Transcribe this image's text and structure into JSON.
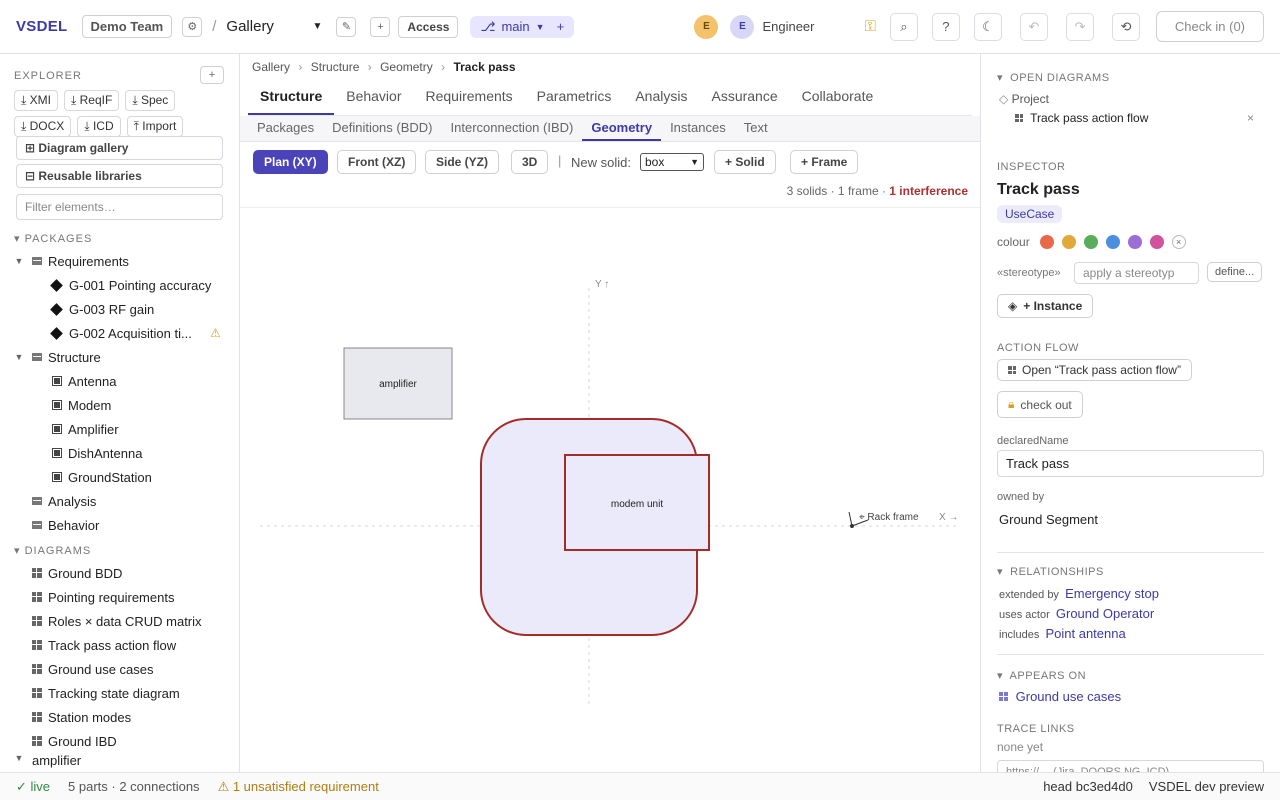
{
  "topbar": {
    "brand": "VSDEL",
    "team": "Demo Team",
    "separator": "/",
    "view_select": "Gallery",
    "access_label": "Access",
    "branch": "main",
    "avatar1": "E",
    "avatar2": "E",
    "role": "Engineer",
    "checkin_label": "Check in (0)"
  },
  "explorer": {
    "title": "EXPLORER",
    "exports": [
      "XMI",
      "ReqIF",
      "Spec",
      "DOCX",
      "ICD",
      "Import"
    ],
    "diagram_gallery": "Diagram gallery",
    "reusable_libraries": "Reusable libraries",
    "filter_placeholder": "Filter elements…",
    "packages_title": "PACKAGES",
    "diagrams_title": "DIAGRAMS",
    "requirements": "Requirements",
    "req_items": [
      "G-001 Pointing accuracy",
      "G-003 RF gain",
      "G-002 Acquisition ti..."
    ],
    "structure": "Structure",
    "structure_items": [
      "Antenna",
      "Modem",
      "Amplifier",
      "DishAntenna",
      "GroundStation"
    ],
    "analysis": "Analysis",
    "behavior": "Behavior",
    "diagrams": [
      "Ground BDD",
      "Pointing requirements",
      "Roles × data CRUD matrix",
      "Track pass action flow",
      "Ground use cases",
      "Tracking state diagram",
      "Station modes",
      "Ground IBD"
    ],
    "cut_item": "amplifier"
  },
  "breadcrumb": {
    "items": [
      "Gallery",
      "Structure",
      "Geometry"
    ],
    "current": "Track pass"
  },
  "tabs": {
    "primary": [
      "Structure",
      "Behavior",
      "Requirements",
      "Parametrics",
      "Analysis",
      "Assurance",
      "Collaborate"
    ],
    "secondary": [
      "Packages",
      "Definitions (BDD)",
      "Interconnection (IBD)",
      "Geometry",
      "Instances",
      "Text"
    ]
  },
  "toolbar": {
    "views": [
      "Plan (XY)",
      "Front (XZ)",
      "Side (YZ)",
      "3D"
    ],
    "new_solid_label": "New solid:",
    "solid_type": "box",
    "add_solid": "+ Solid",
    "add_frame": "+ Frame",
    "summary": "3 solids · 1 frame ·",
    "interference": "1 interference"
  },
  "canvas": {
    "y_axis": "Y ↑",
    "x_axis": "X →",
    "frame_label": "⌖ Rack frame",
    "solid_amplifier": "amplifier",
    "solid_modem": "modem unit"
  },
  "inspector": {
    "open_diagrams_title": "OPEN DIAGRAMS",
    "project": "Project",
    "open_diagram": "Track pass action flow",
    "inspector_title": "INSPECTOR",
    "element_name": "Track pass",
    "element_type": "UseCase",
    "colour_label": "colour",
    "colours": [
      "#e8684a",
      "#e0a93a",
      "#59ad5c",
      "#4a8fe0",
      "#9c6fd6",
      "#d2529c"
    ],
    "stereotype_label": "«stereotype»",
    "stereotype_placeholder": "apply a stereotyp",
    "define_label": "define...",
    "instance_button": "+ Instance",
    "action_flow_title": "ACTION FLOW",
    "open_flow_button": "Open “Track pass action flow”",
    "checkout_button": "check out",
    "declared_name_label": "declaredName",
    "declared_name_value": "Track pass",
    "owned_by_label": "owned by",
    "owned_by_value": "Ground Segment",
    "relationships_title": "RELATIONSHIPS",
    "relationships": [
      {
        "kind": "extended by",
        "target": "Emergency stop"
      },
      {
        "kind": "uses actor",
        "target": "Ground Operator"
      },
      {
        "kind": "includes",
        "target": "Point antenna"
      }
    ],
    "appears_on_title": "APPEARS ON",
    "appears_on": "Ground use cases",
    "trace_links_title": "TRACE LINKS",
    "trace_none": "none yet",
    "trace_placeholder": "https://… (Jira, DOORS NG, ICD)"
  },
  "status": {
    "live": "live",
    "counts": "5 parts · 2 connections",
    "warning": "1 unsatisfied requirement",
    "head": "head bc3ed4d0",
    "preview": "VSDEL dev preview"
  }
}
